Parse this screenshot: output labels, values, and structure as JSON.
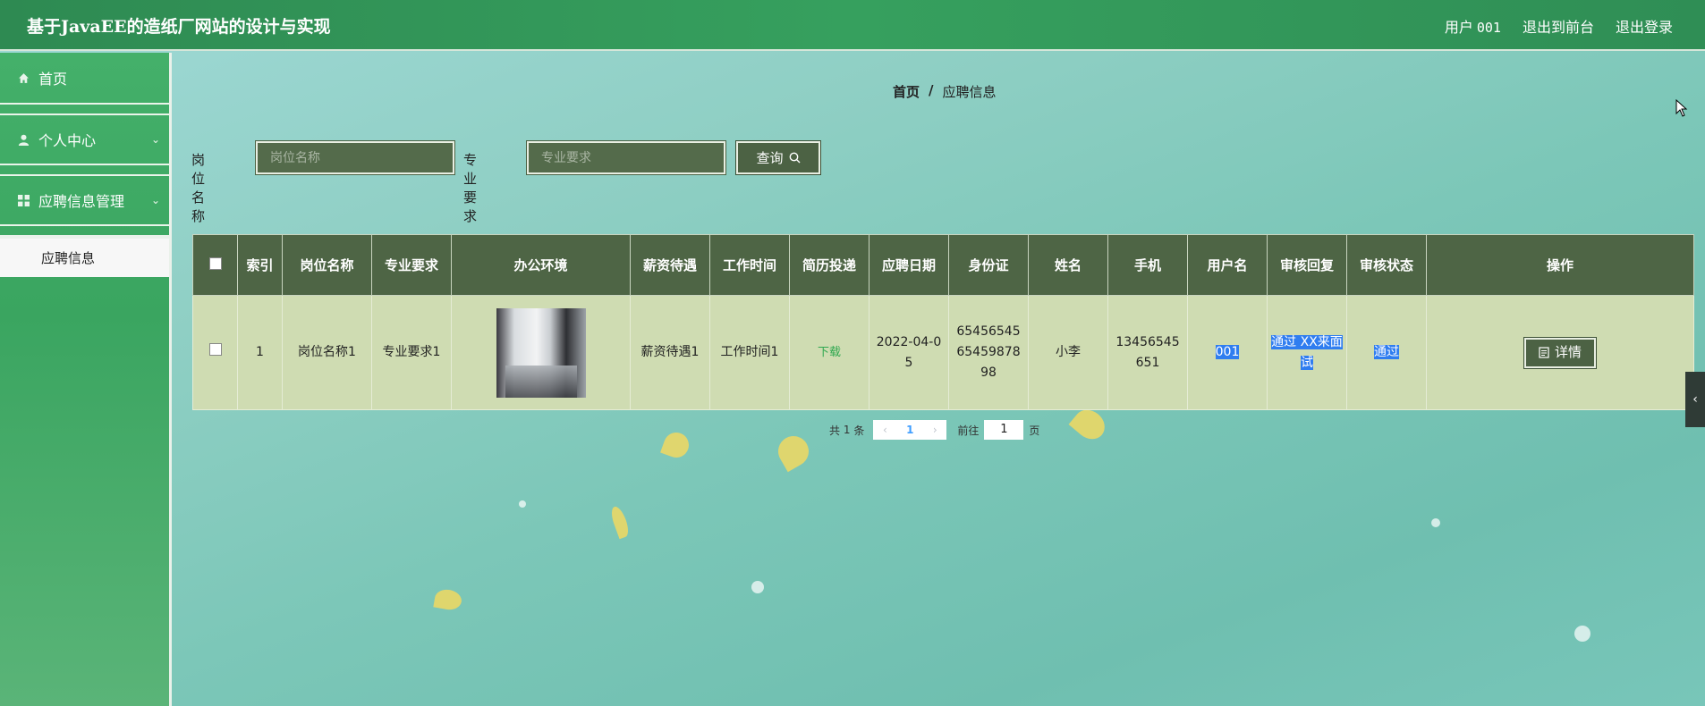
{
  "header": {
    "title": "基于JavaEE的造纸厂网站的设计与实现",
    "user_label": "用户",
    "user_name": "001",
    "to_front": "退出到前台",
    "logout": "退出登录"
  },
  "sidebar": {
    "items": [
      {
        "label": "首页",
        "icon": "home-icon"
      },
      {
        "label": "个人中心",
        "icon": "user-icon"
      },
      {
        "label": "应聘信息管理",
        "icon": "grid-icon"
      }
    ],
    "sub_item": "应聘信息"
  },
  "breadcrumb": {
    "home": "首页",
    "sep": "/",
    "current": "应聘信息"
  },
  "search": {
    "label_position": "岗位名称",
    "placeholder_position": "岗位名称",
    "label_requirement": "专业要求",
    "placeholder_requirement": "专业要求",
    "button": "查询"
  },
  "table": {
    "headers": [
      "",
      "索引",
      "岗位名称",
      "专业要求",
      "办公环境",
      "薪资待遇",
      "工作时间",
      "简历投递",
      "应聘日期",
      "身份证",
      "姓名",
      "手机",
      "用户名",
      "审核回复",
      "审核状态",
      "操作"
    ],
    "rows": [
      {
        "index": "1",
        "position": "岗位名称1",
        "requirement": "专业要求1",
        "salary": "薪资待遇1",
        "work_time": "工作时间1",
        "resume": "下载",
        "date": "2022-04-05",
        "id_card": "654565456545987898",
        "name": "小李",
        "phone": "13456545651",
        "username": "001",
        "reply": "通过 XX来面试",
        "status": "通过",
        "action": "详情"
      }
    ]
  },
  "pagination": {
    "total_prefix": "共",
    "total": "1",
    "total_suffix": "条",
    "current": "1",
    "goto": "前往",
    "goto_value": "1",
    "page_suffix": "页"
  },
  "colors": {
    "header_green": "#36a05e",
    "table_header": "#4e6545",
    "table_row": "#cfdcb2",
    "highlight": "#2f7df0"
  }
}
